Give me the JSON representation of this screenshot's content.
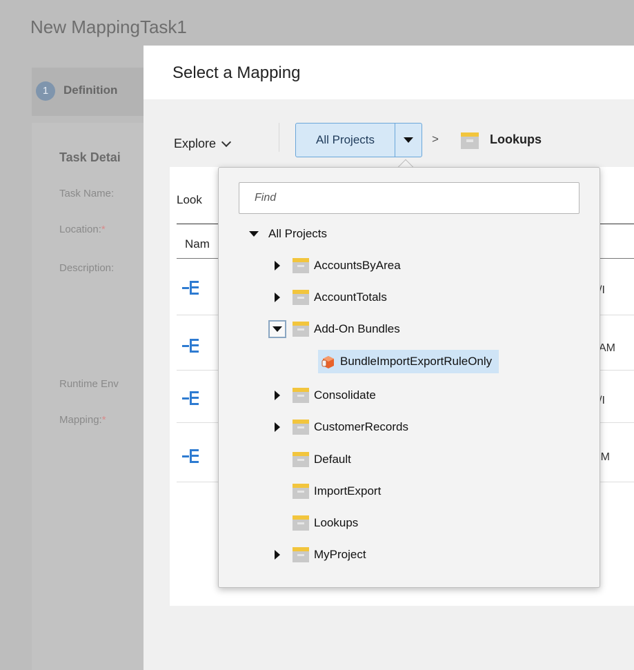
{
  "background": {
    "title": "New MappingTask1",
    "step_number": "1",
    "step_label": "Definition",
    "section_title": "Task Detai",
    "fields": {
      "task_name": "Task Name:",
      "location": "Location:",
      "location_req": "*",
      "description": "Description:",
      "runtime": "Runtime Env",
      "mapping": "Mapping:",
      "mapping_req": "*"
    }
  },
  "modal": {
    "title": "Select a Mapping",
    "explore_label": "Explore",
    "project_button_label": "All Projects",
    "breadcrumb_separator": ">",
    "breadcrumb_current": "Lookups",
    "content": {
      "lookups_label": "Look",
      "name_header": "Nam",
      "row_tails": [
        "/I",
        "AM",
        "/I",
        "PM"
      ]
    }
  },
  "dropdown": {
    "find_placeholder": "Find",
    "tree": {
      "root_label": "All Projects",
      "items": [
        {
          "label": "AccountsByArea"
        },
        {
          "label": "AccountTotals"
        },
        {
          "label": "Add-On Bundles"
        },
        {
          "label": "BundleImportExportRuleOnly"
        },
        {
          "label": "Consolidate"
        },
        {
          "label": "CustomerRecords"
        },
        {
          "label": "Default"
        },
        {
          "label": "ImportExport"
        },
        {
          "label": "Lookups"
        },
        {
          "label": "MyProject"
        }
      ]
    }
  },
  "colors": {
    "accent": "#d6e8f7",
    "accent_border": "#6aa6d9",
    "folder_top": "#f2c53d",
    "folder_body": "#c9c9c9",
    "mapping_icon": "#2e7bd1",
    "bundle_icon": "#e8622a"
  }
}
